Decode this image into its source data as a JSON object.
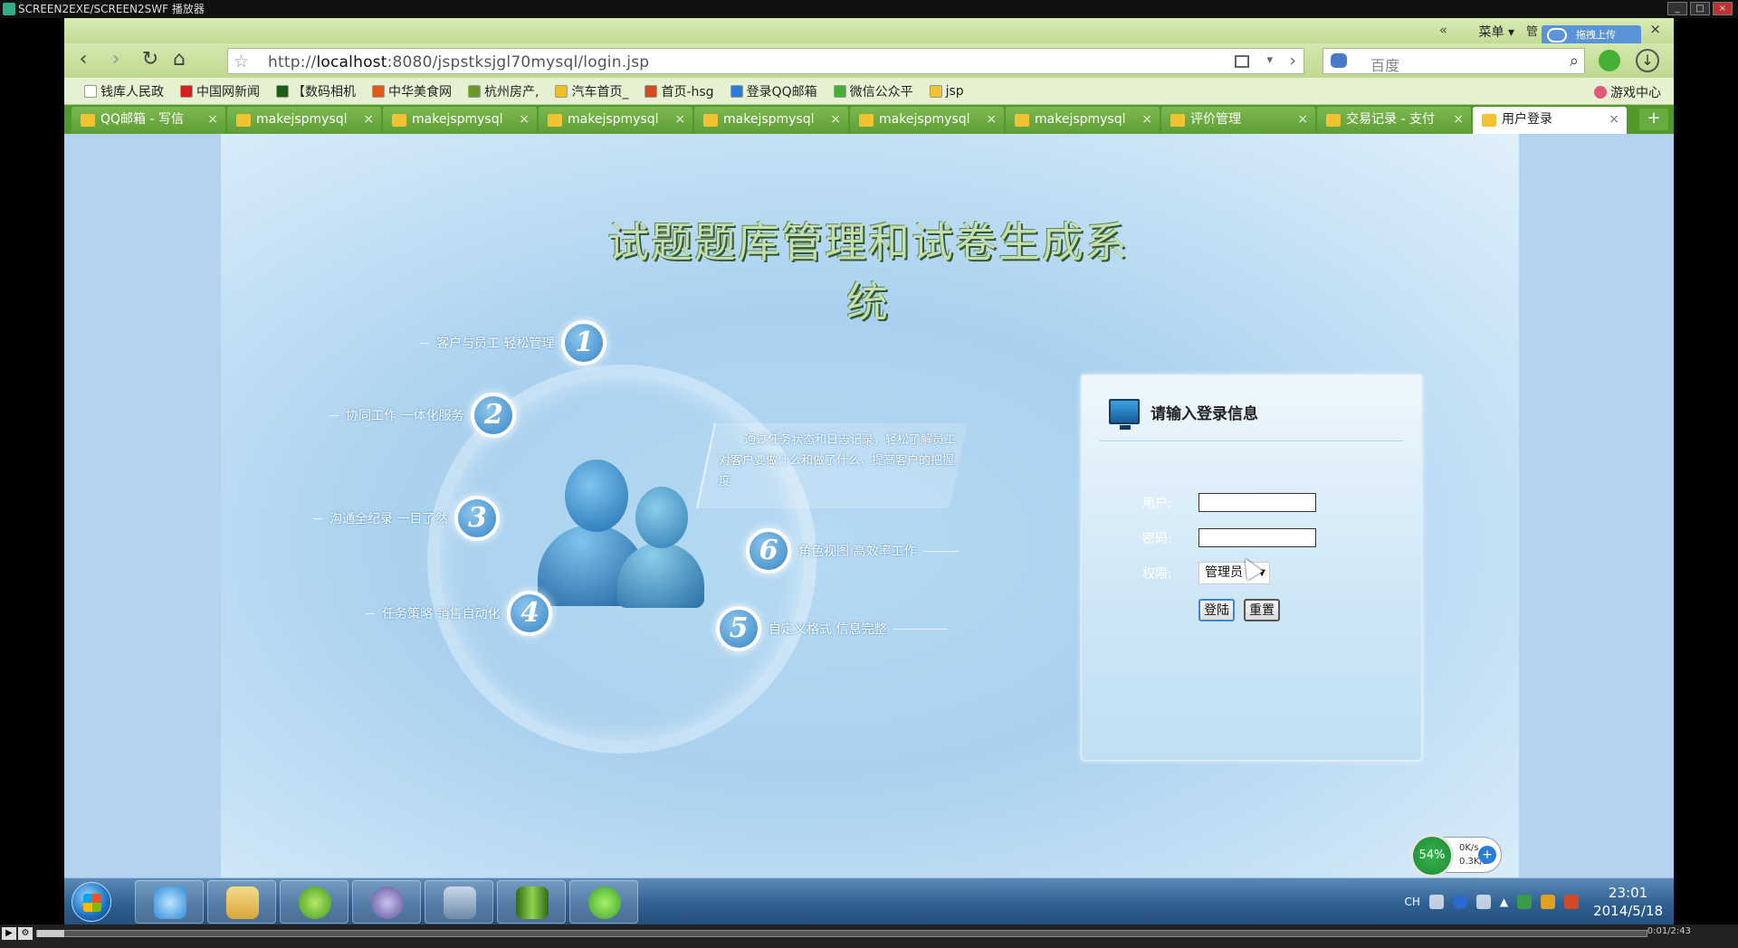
{
  "player": {
    "title": "SCREEN2EXE/SCREEN2SWF 播放器",
    "time": "0:01/2:43"
  },
  "browser": {
    "menu_label": "菜单",
    "upload_label": "拖拽上传",
    "url_prefix": "http://",
    "url_host": "localhost",
    "url_rest": ":8080/jspstksjgl70mysql/login.jsp",
    "search_placeholder": "百度",
    "bookmarks": [
      {
        "label": "钱库人民政",
        "color": "#ffffff"
      },
      {
        "label": "中国网新闻",
        "color": "#d62020"
      },
      {
        "label": "【数码相机",
        "color": "#1a5c1a"
      },
      {
        "label": "中华美食网",
        "color": "#e05a1a"
      },
      {
        "label": "杭州房产,",
        "color": "#6a9a2a"
      },
      {
        "label": "汽车首页_",
        "color": "#f0c020"
      },
      {
        "label": "首页-hsg",
        "color": "#d64a20"
      },
      {
        "label": "登录QQ邮箱",
        "color": "#2a7dd6"
      },
      {
        "label": "微信公众平",
        "color": "#45b035"
      },
      {
        "label": "jsp",
        "color": "#f1c232"
      }
    ],
    "games_label": "游戏中心",
    "tabs": [
      {
        "label": "QQ邮箱 - 写信",
        "active": false
      },
      {
        "label": "makejspmysql",
        "active": false
      },
      {
        "label": "makejspmysql",
        "active": false
      },
      {
        "label": "makejspmysql",
        "active": false
      },
      {
        "label": "makejspmysql",
        "active": false
      },
      {
        "label": "makejspmysql",
        "active": false
      },
      {
        "label": "makejspmysql",
        "active": false
      },
      {
        "label": "评价管理",
        "active": false
      },
      {
        "label": "交易记录 - 支付",
        "active": false
      },
      {
        "label": "用户登录",
        "active": true
      }
    ]
  },
  "page": {
    "system_title": "试题题库管理和试卷生成系统",
    "features": {
      "f1": "客户与员工 轻松管理",
      "f2": "协同工作 一体化服务",
      "f3": "沟通全纪录 一目了然",
      "f4": "任务策略 销售自动化",
      "f5": "自定义格式 信息完整",
      "f6": "角色视图 高效率工作"
    },
    "feature_numbers": {
      "n1": "1",
      "n2": "2",
      "n3": "3",
      "n4": "4",
      "n5": "5",
      "n6": "6"
    },
    "callout": "通过任务状态和日志记录，轻松了解员工对客户要做什么和做了什么，提高客户的把握度",
    "login": {
      "title": "请输入登录信息",
      "user_label": "用户:",
      "password_label": "密码:",
      "role_label": "权限:",
      "role_value": "管理员",
      "user_value": "",
      "password_value": "",
      "login_button": "登陆",
      "reset_button": "重置"
    }
  },
  "taskbar": {
    "lang": "CH",
    "clock_time": "23:01",
    "clock_date": "2014/5/18",
    "net_percent": "54%",
    "up_rate": "0K/s",
    "down_rate": "0.3K/s"
  }
}
